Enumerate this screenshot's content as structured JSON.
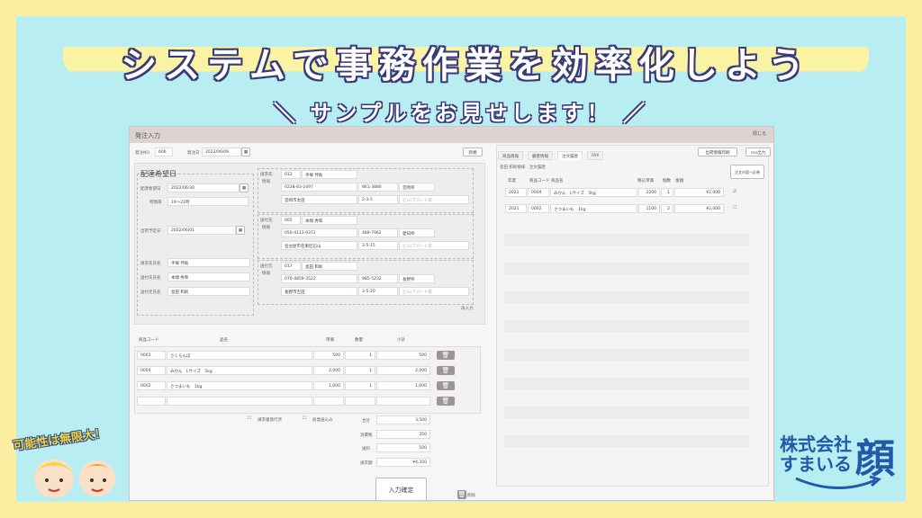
{
  "banner": {
    "title": "システムで事務作業を効率化しよう",
    "subtitle": "＼ サンプルをお見せします！ ／"
  },
  "window": {
    "title": "発注入力",
    "close": "閉じる"
  },
  "order": {
    "no_label": "発注NO",
    "no": "606",
    "date_label": "発注日",
    "date": "2022/06/09",
    "new_btn": "新規"
  },
  "delivery": {
    "heading": "配達希望日",
    "date_label": "配達希望日",
    "date": "2022/06/30",
    "time_label": "時間帯",
    "time": "19～21時",
    "ship_label": "出荷予定日",
    "ship": "2022/06/01",
    "billto_label": "請求先氏名",
    "billto": "手塚 伴助",
    "sendto_label": "送付先氏名",
    "sendto": "本間 秀和",
    "sender_label": "送付元氏名",
    "sender": "島田 和則"
  },
  "addr_blocks": [
    {
      "label1": "請求先",
      "label2": "情報",
      "code": "012",
      "name": "手塚 伴助",
      "tel": "0228-83-2497",
      "zip": "861-3880",
      "pref": "宮崎県",
      "city": "宮崎市太田",
      "addr": "2-3-5",
      "bldg": "ビル/アパート等"
    },
    {
      "label1": "送付先",
      "label2": "情報",
      "code": "005",
      "name": "本間 秀和",
      "tel": "050-4113-0372",
      "zip": "489-7962",
      "pref": "愛知県",
      "city": "名古屋市名東区石山",
      "addr": "3-5-15",
      "bldg": "ビル/アパート等"
    },
    {
      "label1": "送付元",
      "label2": "情報",
      "code": "017",
      "name": "島田 和則",
      "tel": "070-4859-3522",
      "zip": "985-5232",
      "pref": "長野県",
      "city": "長野市吉田",
      "addr": "3-5-20",
      "bldg": "ビル/アパート等"
    }
  ],
  "reinput": "再入力",
  "items": {
    "headers": [
      "商品コード",
      "品名",
      "単価",
      "数量",
      "小計"
    ],
    "rows": [
      {
        "code": "0003",
        "name": "さくらんぼ",
        "price": "500",
        "qty": "1",
        "sub": "500"
      },
      {
        "code": "0004",
        "name": "みかん　Lサイズ　5kg",
        "price": "2,000",
        "qty": "1",
        "sub": "2,000"
      },
      {
        "code": "0002",
        "name": "さつまいも　1kg",
        "price": "1,000",
        "qty": "1",
        "sub": "1,000"
      },
      {
        "code": "",
        "name": "",
        "price": "",
        "qty": "",
        "sub": ""
      }
    ]
  },
  "checks": {
    "a": "請求書発行済",
    "b": "仮発送込み"
  },
  "totals": [
    {
      "label": "合計",
      "value": "3,500"
    },
    {
      "label": "消費税",
      "value": "350"
    },
    {
      "label": "送料",
      "value": "500"
    },
    {
      "label": "請求額",
      "value": "¥4,350"
    }
  ],
  "confirm": "入力確定",
  "delete": "削除",
  "right": {
    "tabs": [
      "商品情報",
      "顧客情報",
      "注文履歴",
      "FAX"
    ],
    "btn_print": "出荷情報印刷",
    "btn_csv": "csv出力",
    "btn_reflect": "注文内容へ反映",
    "customer": "島田 和則様様　注文履歴",
    "headers": [
      "年度",
      "商品コード",
      "商品名",
      "税込単価",
      "個数",
      "金額"
    ],
    "rows": [
      {
        "year": "2021",
        "code": "0004",
        "name": "みかん　Lサイズ　5kg",
        "price": "2200",
        "qty": "1",
        "amount": "¥2,000"
      },
      {
        "year": "2021",
        "code": "0002",
        "name": "さつまいも　1kg",
        "price": "1100",
        "qty": "2",
        "amount": "¥2,000"
      }
    ]
  },
  "mascot": {
    "text": "可能性は無限大！"
  },
  "logo": {
    "line1": "株式会社",
    "line2": "すまいる",
    "kanji": "顔"
  }
}
